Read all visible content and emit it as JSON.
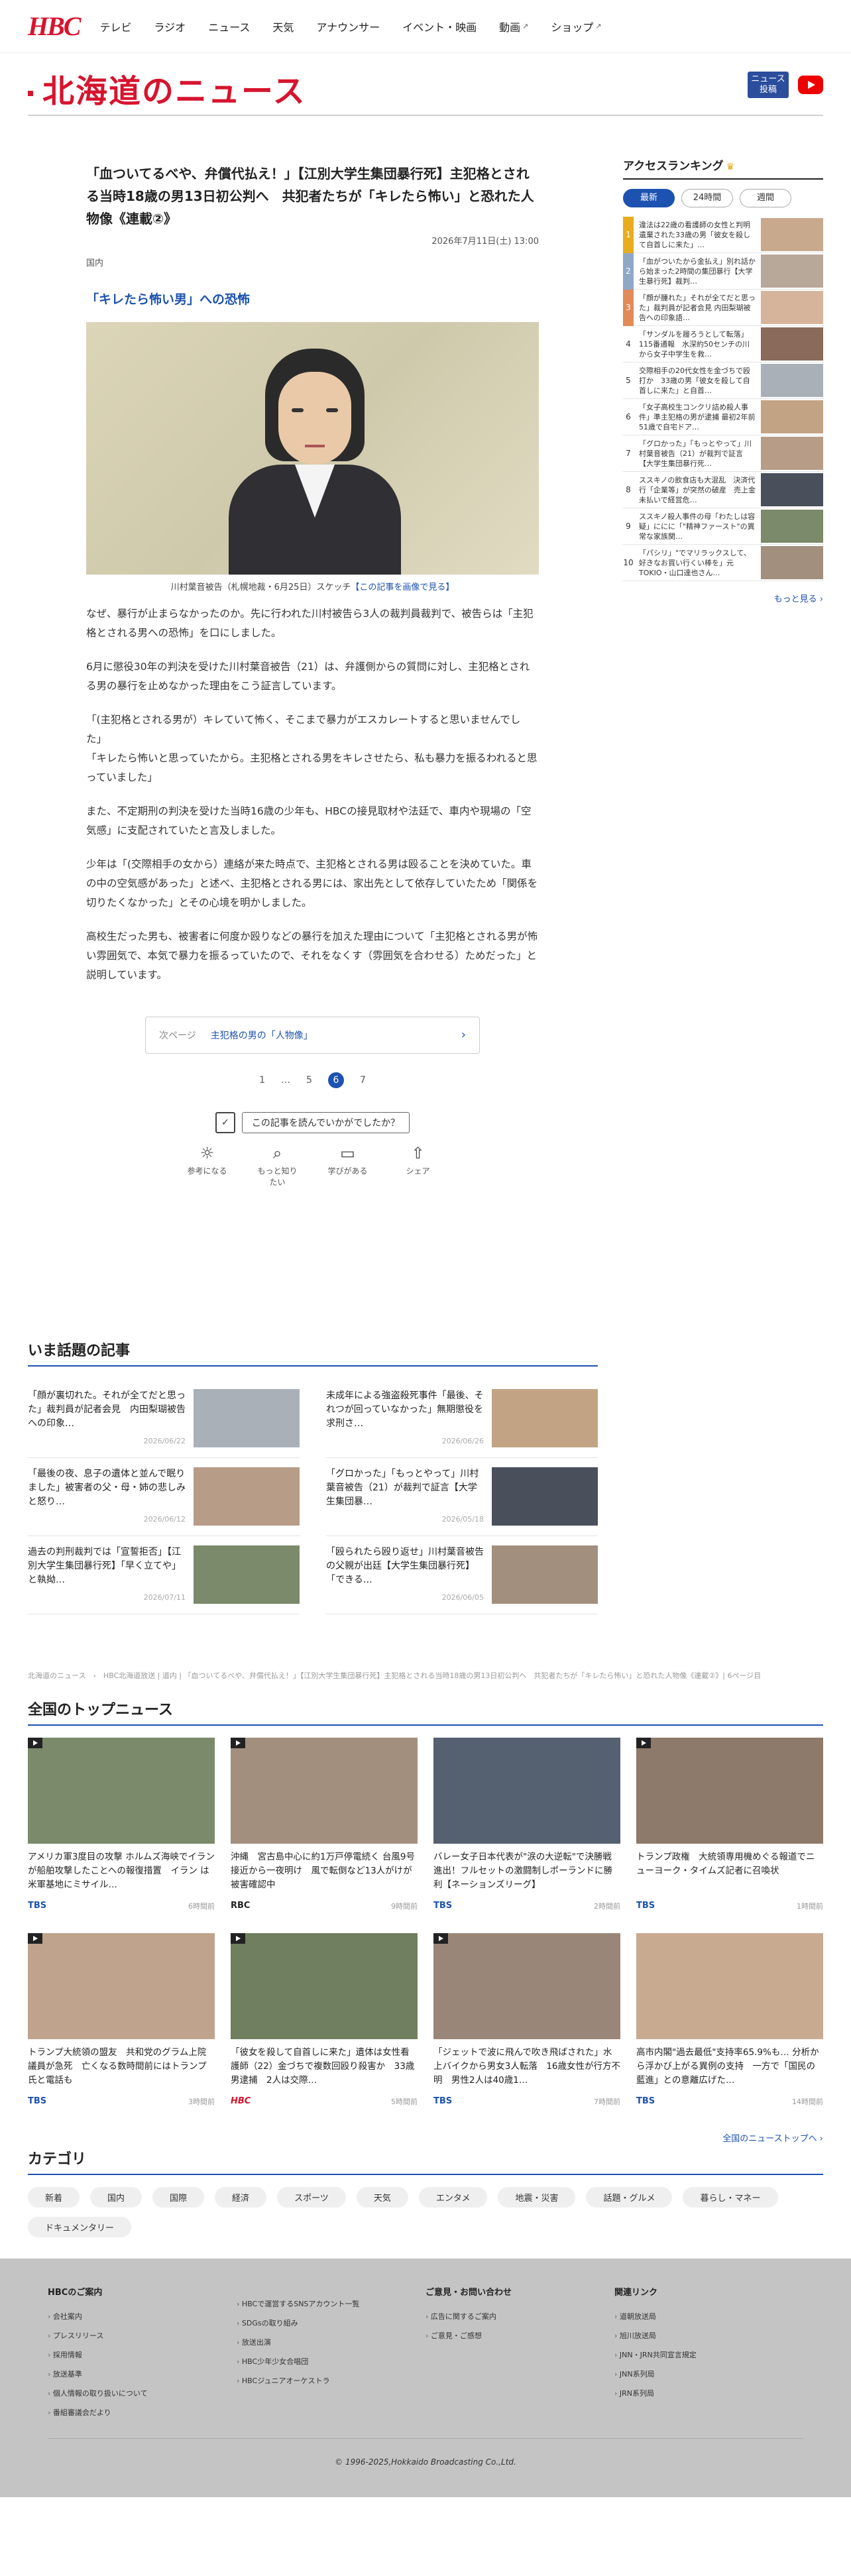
{
  "nav": {
    "logo": "HBC",
    "items": [
      {
        "label": "テレビ",
        "ext": false
      },
      {
        "label": "ラジオ",
        "ext": false
      },
      {
        "label": "ニュース",
        "ext": false
      },
      {
        "label": "天気",
        "ext": false
      },
      {
        "label": "アナウンサー",
        "ext": false
      },
      {
        "label": "イベント・映画",
        "ext": false
      },
      {
        "label": "動画",
        "ext": true
      },
      {
        "label": "ショップ",
        "ext": true
      }
    ]
  },
  "section": {
    "title": "北海道のニュース",
    "badge": "ニュース\n投稿"
  },
  "article": {
    "title": "「血ついてるべや、弁償代払え！」【江別大学生集団暴行死】主犯格とされる当時18歳の男13日初公判へ　共犯者たちが「キレたら怖い」と恐れた人物像《連載②》",
    "date": "2026年7月11日(土) 13:00",
    "category": "国内",
    "subtitle": "「キレたら怖い男」への恐怖",
    "caption": "川村葉音被告（札幌地裁・6月25日）スケッチ",
    "caption_link": "【この記事を画像で見る】",
    "paragraphs": [
      "なぜ、暴行が止まらなかったのか。先に行われた川村被告ら3人の裁判員裁判で、被告らは「主犯格とされる男への恐怖」を口にしました。",
      "6月に懲役30年の判決を受けた川村葉音被告（21）は、弁護側からの質問に対し、主犯格とされる男の暴行を止めなかった理由をこう証言しています。",
      "「(主犯格とされる男が）キレていて怖く、そこまで暴力がエスカレートすると思いませんでした」\n「キレたら怖いと思っていたから。主犯格とされる男をキレさせたら、私も暴力を振るわれると思っていました」",
      "また、不定期刑の判決を受けた当時16歳の少年も、HBCの接見取材や法廷で、車内や現場の「空気感」に支配されていたと言及しました。",
      "少年は「(交際相手の女から）連絡が来た時点で、主犯格とされる男は殴ることを決めていた。車の中の空気感があった」と述べ、主犯格とされる男には、家出先として依存していたため「関係を切りたくなかった」とその心境を明かしました。",
      "高校生だった男も、被害者に何度か殴りなどの暴行を加えた理由について「主犯格とされる男が怖い雰囲気で、本気で暴力を振るっていたので、それをなくす（雰囲気を合わせる）ためだった」と説明しています。"
    ],
    "next_label": "次ページ",
    "next_link": "主犯格の男の「人物像」",
    "pager": [
      "1",
      "…",
      "5",
      "6",
      "7"
    ],
    "feedback_q": "この記事を読んでいかがでしたか？",
    "reactions": [
      {
        "icon": "lightbulb-icon",
        "label": "参考になる"
      },
      {
        "icon": "search-icon",
        "label": "もっと知りたい"
      },
      {
        "icon": "book-icon",
        "label": "学びがある"
      },
      {
        "icon": "share-icon",
        "label": "シェア"
      }
    ]
  },
  "ranking": {
    "title": "アクセスランキング",
    "tabs": [
      "最新",
      "24時間",
      "週間"
    ],
    "items": [
      {
        "n": "1",
        "text": "違法は22歳の看護師の女性と判明　遺棄された33歳の男「彼女を殺して自首しに来た」…"
      },
      {
        "n": "2",
        "text": "「血がついたから金払え」別れ話から始まった2時間の集団暴行【大学生暴行死】裁判…"
      },
      {
        "n": "3",
        "text": "「顔が腫れた」それが全てだと思った」裁判員が記者会見 内田梨瑚被告への印象語…"
      },
      {
        "n": "4",
        "text": "「サンダルを履ろうとして転落」115番通報　水深約50センチの川から女子中学生を救…"
      },
      {
        "n": "5",
        "text": "交際相手の20代女性を金づちで殴打か　33歳の男「彼女を殺して自首しに来た」と自首…"
      },
      {
        "n": "6",
        "text": "「女子高校生コンクリ詰め殺人事件」準主犯格の男が逮捕 最初2年前51歳で自宅ドア…"
      },
      {
        "n": "7",
        "text": "「グロかった」「もっとやって」川村葉音被告（21）が裁判で証言【大学生集団暴行死…"
      },
      {
        "n": "8",
        "text": "ススキノの飲食店も大混乱　決済代行「企業等」が突然の破産　売上金未払いで経営危…"
      },
      {
        "n": "9",
        "text": "ススキノ殺人事件の母「わたしは容疑」ににに「\"精神ファースト\"の異常な家族関…"
      },
      {
        "n": "10",
        "text": "「パシリ」\"でマリラックスして、好きなお買い行くい棒を」元TOKIO・山口達也さん…"
      }
    ],
    "more": "もっと見る"
  },
  "topics": {
    "title": "いま話題の記事",
    "items": [
      {
        "text": "「顔が裏切れた。それが全てだと思った」裁判員が記者会見　内田梨瑚被告への印象…",
        "date": "2026/06/22"
      },
      {
        "text": "未成年による強盗殺死事件「最後、それつが回っていなかった」無期懲役を求刑さ…",
        "date": "2026/06/26"
      },
      {
        "text": "「最後の夜、息子の遺体と並んで眠りました」被害者の父・母・姉の悲しみと怒り…",
        "date": "2026/06/12"
      },
      {
        "text": "「グロかった」「もっとやって」川村葉音被告（21）が裁判で証言【大学生集団暴…",
        "date": "2026/05/18"
      },
      {
        "text": "過去の判刑裁判では「宣誓拒否」【江別大学生集団暴行死】「早く立てや」と執拗…",
        "date": "2026/07/11"
      },
      {
        "text": "「殴られたら殴り返せ」川村葉音被告の父親が出廷【大学生集団暴行死】「できる…",
        "date": "2026/06/05"
      }
    ]
  },
  "breadcrumb": "北海道のニュース　›　HBC北海道放送 | 道内 | 「血ついてるべや、弁償代払え！」【江別大学生集団暴行死】主犯格とされる当時18歳の男13日初公判へ　共犯者たちが「キレたら怖い」と恐れた人物像《連載②》| 6ページ目",
  "national": {
    "title": "全国のトップニュース",
    "items": [
      {
        "title": "アメリカ軍3度目の攻撃 ホルムズ海峡でイランが船舶攻撃したことへの報復措置　イラン は米軍基地にミサイル…",
        "src": "TBS",
        "date": "6時間前",
        "video": true
      },
      {
        "title": "沖縄　宮古島中心に約1万戸停電続く 台風9号接近から一夜明け　風で転倒など13人がけが　被害確認中",
        "src": "RBC",
        "date": "9時間前",
        "video": true
      },
      {
        "title": "バレー女子日本代表が\"涙の大逆転\"で決勝戦進出！フルセットの激闘制しポーランドに勝利【ネーションズリーグ】",
        "src": "TBS",
        "date": "2時間前",
        "video": false
      },
      {
        "title": "トランプ政権　大統領専用機めぐる報道でニューヨーク・タイムズ記者に召喚状",
        "src": "TBS",
        "date": "1時間前",
        "video": true
      },
      {
        "title": "トランプ大統領の盟友　共和党のグラム上院議員が急死　亡くなる数時間前にはトランプ氏と電話も",
        "src": "TBS",
        "date": "3時間前",
        "video": true
      },
      {
        "title": "「彼女を殺して自首しに来た」遺体は女性看護師（22）金づちで複数回殴り殺害か　33歳男逮捕　2人は交際…",
        "src": "HBC",
        "date": "5時間前",
        "video": true
      },
      {
        "title": "「ジェットで波に飛んで吹き飛ばされた」水上バイクから男女3人転落　16歳女性が行方不明　男性2人は40歳1…",
        "src": "TBS",
        "date": "7時間前",
        "video": true
      },
      {
        "title": "高市内閣\"過去最低\"支持率65.9%も… 分析から浮かび上がる異例の支持　一方で「国民の藍進」との意離広げた…",
        "src": "TBS",
        "date": "14時間前",
        "video": false
      }
    ],
    "more": "全国のニューストップへ"
  },
  "categories": {
    "title": "カテゴリ",
    "items": [
      "新着",
      "国内",
      "国際",
      "経済",
      "スポーツ",
      "天気",
      "エンタメ",
      "地震・災害",
      "話題・グルメ",
      "暮らし・マネー",
      "ドキュメンタリー"
    ]
  },
  "footer": {
    "cols": [
      {
        "title": "HBCのご案内",
        "items": [
          "会社案内",
          "プレスリリース",
          "採用情報",
          "放送基準",
          "個人情報の取り扱いについて",
          "番組審議会だより"
        ]
      },
      {
        "title": "",
        "items": [
          "HBCで運営するSNSアカウント一覧",
          "SDGsの取り組み",
          "放送出演",
          "HBC少年少女合唱団",
          "HBCジュニアオーケストラ"
        ]
      },
      {
        "title": "ご意見・お問い合わせ",
        "items": [
          "広告に関するご案内",
          "ご意見・ご感想"
        ]
      },
      {
        "title": "関連リンク",
        "items": [
          "道朝放送局",
          "旭川放送局",
          "JNN・JRN共同宣言規定",
          "JNN系列局",
          "JRN系列局"
        ]
      }
    ],
    "copyright": "© 1996-2025,Hokkaido Broadcasting Co.,Ltd."
  },
  "colors": {
    "brand": "#d7142e",
    "accent": "#1d52b0"
  }
}
